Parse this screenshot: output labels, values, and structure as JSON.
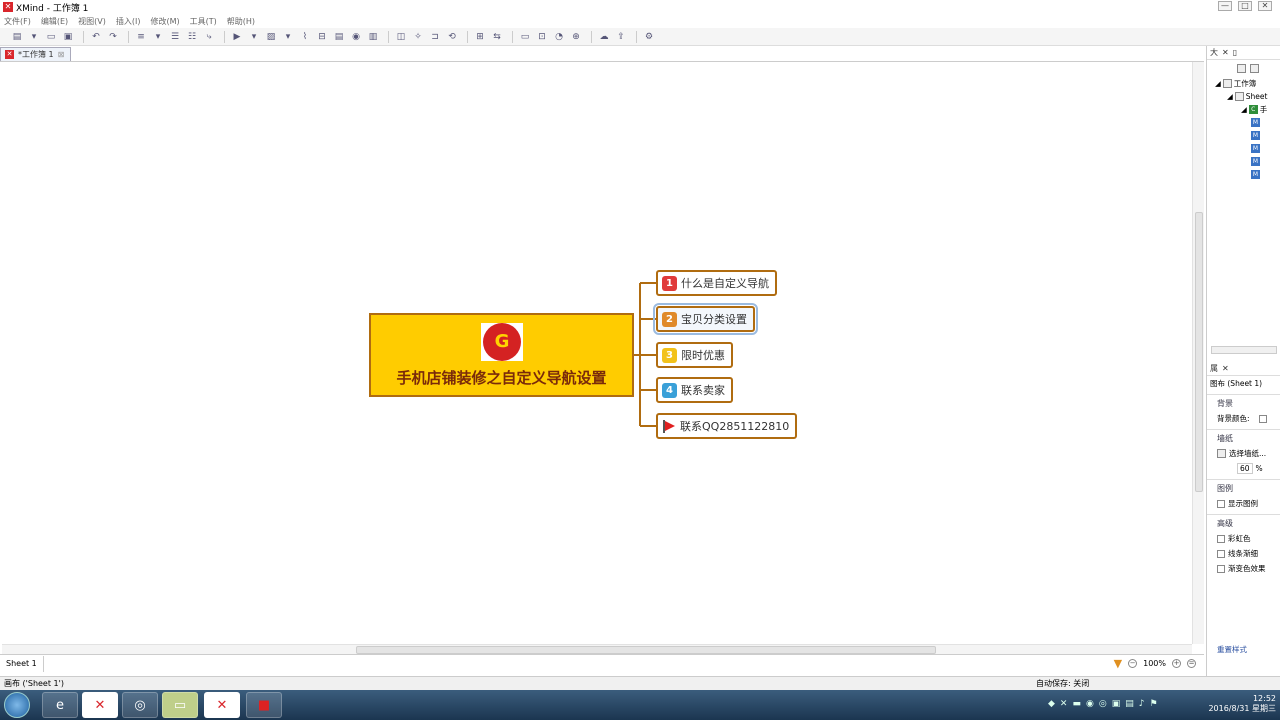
{
  "window": {
    "title": "XMind - 工作簿 1",
    "min": "—",
    "max": "□",
    "close": "✕"
  },
  "menu": [
    "文件(F)",
    "编辑(E)",
    "视图(V)",
    "插入(I)",
    "修改(M)",
    "工具(T)",
    "帮助(H)"
  ],
  "editor_tab": {
    "label": "*工作簿 1",
    "close": "⊠"
  },
  "map": {
    "central": {
      "label": "手机店铺装修之自定义导航设置",
      "logo_text": "G"
    },
    "topics": [
      {
        "marker": "1",
        "label": "什么是自定义导航",
        "marker_color": "#e03a3a"
      },
      {
        "marker": "2",
        "label": "宝贝分类设置",
        "marker_color": "#e08a2a"
      },
      {
        "marker": "3",
        "label": "限时优惠",
        "marker_color": "#f2c21a"
      },
      {
        "marker": "4",
        "label": "联系卖家",
        "marker_color": "#3aa0d8"
      },
      {
        "marker": "flag",
        "label": "联系QQ2851122810",
        "marker_color": "#e02020"
      }
    ],
    "line_color": "#b06c10",
    "central_fill": "#ffcc00"
  },
  "sheet_tab": "Sheet 1",
  "zoom": {
    "level": "100%"
  },
  "status": {
    "left": "画布 ('Sheet 1')",
    "autosave": "自动保存: 关闭"
  },
  "outline_panel": {
    "title": "大",
    "rows": [
      {
        "label": "工作簿",
        "indent": 1
      },
      {
        "label": "Sheet",
        "indent": 2
      },
      {
        "label": "手",
        "indent": 3
      }
    ],
    "m_rows": 5
  },
  "props_panel": {
    "title": "属",
    "subtitle": "图布 (Sheet 1)",
    "sections": {
      "background": "背景",
      "bg_color_label": "背景颜色:",
      "wallpaper": "墙纸",
      "choose_wallpaper": "选择墙纸...",
      "opacity": "60",
      "percent": "%",
      "legend": "图例",
      "show_legend": "显示图例",
      "advanced": "高级",
      "rainbow": "彩虹色",
      "taper": "线条渐细",
      "gradient": "渐变色效果",
      "reset": "重置样式"
    }
  },
  "taskbar": {
    "time": "12:52",
    "date": "2016/8/31 星期三"
  }
}
